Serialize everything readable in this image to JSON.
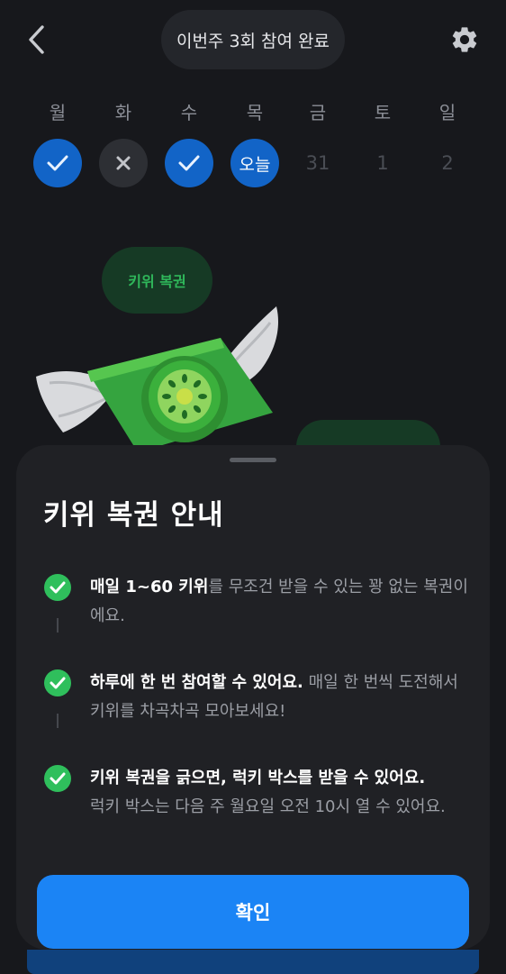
{
  "header": {
    "status": "이번주 3회 참여 완료",
    "back_icon": "chevron-left-icon",
    "settings_icon": "gear-icon"
  },
  "week": {
    "days": [
      {
        "label": "월",
        "state": "done",
        "mark": ""
      },
      {
        "label": "화",
        "state": "miss",
        "mark": ""
      },
      {
        "label": "수",
        "state": "done",
        "mark": ""
      },
      {
        "label": "목",
        "state": "today",
        "mark": "오늘"
      },
      {
        "label": "금",
        "state": "future",
        "mark": "31"
      },
      {
        "label": "토",
        "state": "future",
        "mark": "1"
      },
      {
        "label": "일",
        "state": "future",
        "mark": "2"
      }
    ]
  },
  "background": {
    "chip_label": "키위 복권"
  },
  "sheet": {
    "title": "키위 복권 안내",
    "items": [
      {
        "highlight": "매일 1~60 키위",
        "rest": "를 무조건 받을 수 있는 꽝 없는 복권이에요."
      },
      {
        "highlight": "하루에 한 번 참여할 수 있어요.",
        "rest": " 매일 한 번씩 도전해서 키위를 차곡차곡 모아보세요!"
      },
      {
        "highlight": "키위 복권을 긁으면, 럭키 박스를 받을 수 있어요.",
        "rest": "럭키 박스는 다음 주 월요일 오전 10시 열 수 있어요."
      }
    ],
    "confirm_label": "확인"
  },
  "colors": {
    "background": "#17181c",
    "sheet": "#202125",
    "accent_blue": "#1b84f5",
    "check_green": "#2fbf5c"
  }
}
